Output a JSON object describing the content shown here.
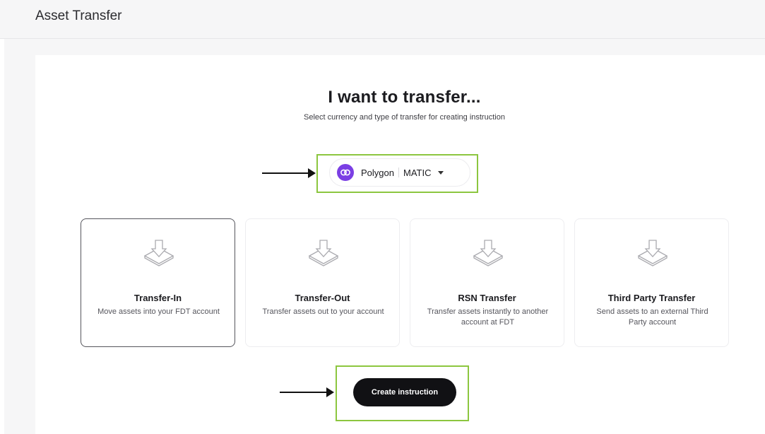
{
  "header": {
    "title": "Asset Transfer"
  },
  "main": {
    "heading": "I want to transfer...",
    "subheading": "Select currency and type of transfer for creating instruction"
  },
  "currency_selector": {
    "network": "Polygon",
    "currency": "MATIC",
    "icon": "polygon-logo-icon",
    "icon_color": "#7b3fe4"
  },
  "options": [
    {
      "title": "Transfer-In",
      "description": "Move assets into your FDT account",
      "selected": true
    },
    {
      "title": "Transfer-Out",
      "description": "Transfer assets out to your account",
      "selected": false
    },
    {
      "title": "RSN Transfer",
      "description": "Transfer assets instantly to another account at FDT",
      "selected": false
    },
    {
      "title": "Third Party Transfer",
      "description": "Send assets to an external Third Party account",
      "selected": false
    }
  ],
  "actions": {
    "create_label": "Create instruction"
  },
  "annotations": {
    "highlight_color": "#8cc63f",
    "arrow_color": "#111111"
  }
}
